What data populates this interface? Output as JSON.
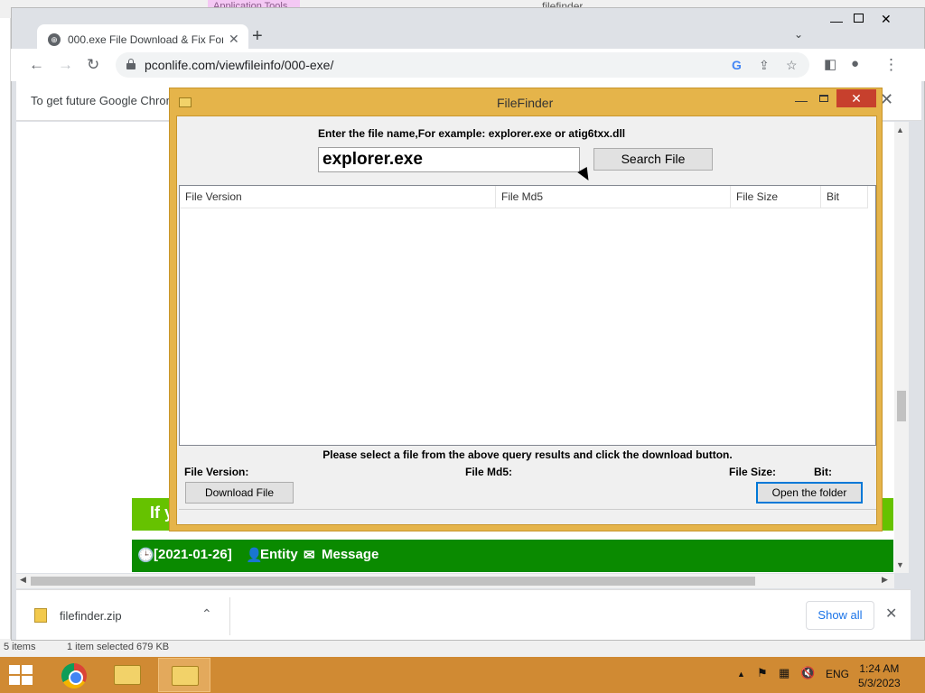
{
  "explorer": {
    "ribbon_tab": "Application Tools",
    "title": "filefinder",
    "status_items": "5 items",
    "status_selected": "1 item selected  679 KB"
  },
  "browser": {
    "tab_title": "000.exe File Download & Fix For",
    "url": "pconlife.com/viewfileinfo/000-exe/",
    "infobar_text": "To get future Google Chrome",
    "icons": [
      "back-icon",
      "forward-icon",
      "reload-icon",
      "lock-icon",
      "google-icon",
      "share-icon",
      "star-icon",
      "side-panel-icon",
      "profile-icon",
      "menu-icon"
    ]
  },
  "page": {
    "banner_text": "If y",
    "date": "[2021-01-26]",
    "entity_label": "Entity",
    "message_label": "Message"
  },
  "downloads": {
    "file_name": "filefinder.zip",
    "show_all": "Show all"
  },
  "filefinder": {
    "title": "FileFinder",
    "prompt": "Enter the file name,For example: explorer.exe or atig6txx.dll",
    "input_value": "explorer.exe",
    "search_button": "Search File",
    "columns": [
      "File Version",
      "File Md5",
      "File Size",
      "Bit"
    ],
    "hint": "Please select a file from the above query results and click the download button.",
    "fields": {
      "version": "File Version:",
      "md5": "File Md5:",
      "size": "File Size:",
      "bit": "Bit:"
    },
    "download_button": "Download File",
    "open_folder_button": "Open the folder"
  },
  "taskbar": {
    "language": "ENG",
    "time": "1:24 AM",
    "date": "5/3/2023"
  },
  "colors": {
    "filefinder_frame": "#e5b44a",
    "banner_green": "#66c200",
    "bar_green": "#0a8a00",
    "taskbar": "#d08a33",
    "close_red": "#c7402d"
  }
}
